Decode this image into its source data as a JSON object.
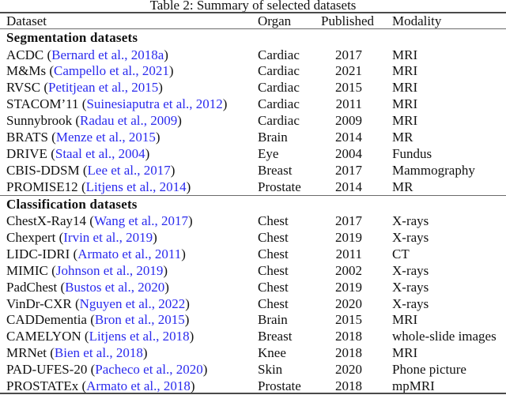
{
  "caption": "Table 2: Summary of selected datasets",
  "header": {
    "dataset": "Dataset",
    "organ": "Organ",
    "published": "Published",
    "modality": "Modality"
  },
  "sections": [
    {
      "title": "Segmentation datasets",
      "rows": [
        {
          "name": "ACDC",
          "citation": "Bernard et al., 2018a",
          "organ": "Cardiac",
          "published": "2017",
          "modality": "MRI"
        },
        {
          "name": "M&Ms",
          "citation": "Campello et al., 2021",
          "organ": "Cardiac",
          "published": "2021",
          "modality": "MRI"
        },
        {
          "name": "RVSC",
          "citation": "Petitjean et al., 2015",
          "organ": "Cardiac",
          "published": "2015",
          "modality": "MRI"
        },
        {
          "name": "STACOM’11",
          "citation": "Suinesiaputra et al., 2012",
          "organ": "Cardiac",
          "published": "2011",
          "modality": "MRI"
        },
        {
          "name": "Sunnybrook",
          "citation": "Radau et al., 2009",
          "organ": "Cardiac",
          "published": "2009",
          "modality": "MRI"
        },
        {
          "name": "BRATS",
          "citation": "Menze et al., 2015",
          "organ": "Brain",
          "published": "2014",
          "modality": "MR"
        },
        {
          "name": "DRIVE",
          "citation": "Staal et al., 2004",
          "organ": "Eye",
          "published": "2004",
          "modality": "Fundus"
        },
        {
          "name": "CBIS-DDSM",
          "citation": "Lee et al., 2017",
          "organ": "Breast",
          "published": "2017",
          "modality": "Mammography"
        },
        {
          "name": "PROMISE12",
          "citation": "Litjens et al., 2014",
          "organ": "Prostate",
          "published": "2014",
          "modality": "MR"
        }
      ]
    },
    {
      "title": "Classification datasets",
      "rows": [
        {
          "name": "ChestX-Ray14",
          "citation": "Wang et al., 2017",
          "organ": "Chest",
          "published": "2017",
          "modality": "X-rays"
        },
        {
          "name": "Chexpert",
          "citation": "Irvin et al., 2019",
          "organ": "Chest",
          "published": "2019",
          "modality": "X-rays"
        },
        {
          "name": "LIDC-IDRI",
          "citation": "Armato et al., 2011",
          "organ": "Chest",
          "published": "2011",
          "modality": "CT"
        },
        {
          "name": "MIMIC",
          "citation": "Johnson et al., 2019",
          "organ": "Chest",
          "published": "2002",
          "modality": "X-rays"
        },
        {
          "name": "PadChest",
          "citation": "Bustos et al., 2020",
          "organ": "Chest",
          "published": "2019",
          "modality": "X-rays"
        },
        {
          "name": "VinDr-CXR",
          "citation": "Nguyen et al., 2022",
          "organ": "Chest",
          "published": "2020",
          "modality": "X-rays"
        },
        {
          "name": "CADDementia",
          "citation": "Bron et al., 2015",
          "organ": "Brain",
          "published": "2015",
          "modality": "MRI"
        },
        {
          "name": "CAMELYON",
          "citation": "Litjens et al., 2018",
          "organ": "Breast",
          "published": "2018",
          "modality": "whole-slide images"
        },
        {
          "name": "MRNet",
          "citation": "Bien et al., 2018",
          "organ": "Knee",
          "published": "2018",
          "modality": "MRI"
        },
        {
          "name": "PAD-UFES-20",
          "citation": "Pacheco et al., 2020",
          "organ": "Skin",
          "published": "2020",
          "modality": "Phone picture"
        },
        {
          "name": "PROSTATEx",
          "citation": "Armato et al., 2018",
          "organ": "Prostate",
          "published": "2018",
          "modality": "mpMRI"
        }
      ]
    }
  ],
  "colors": {
    "citation": "#2b2bee",
    "text": "#111111",
    "rule": "#4a4a4a"
  }
}
